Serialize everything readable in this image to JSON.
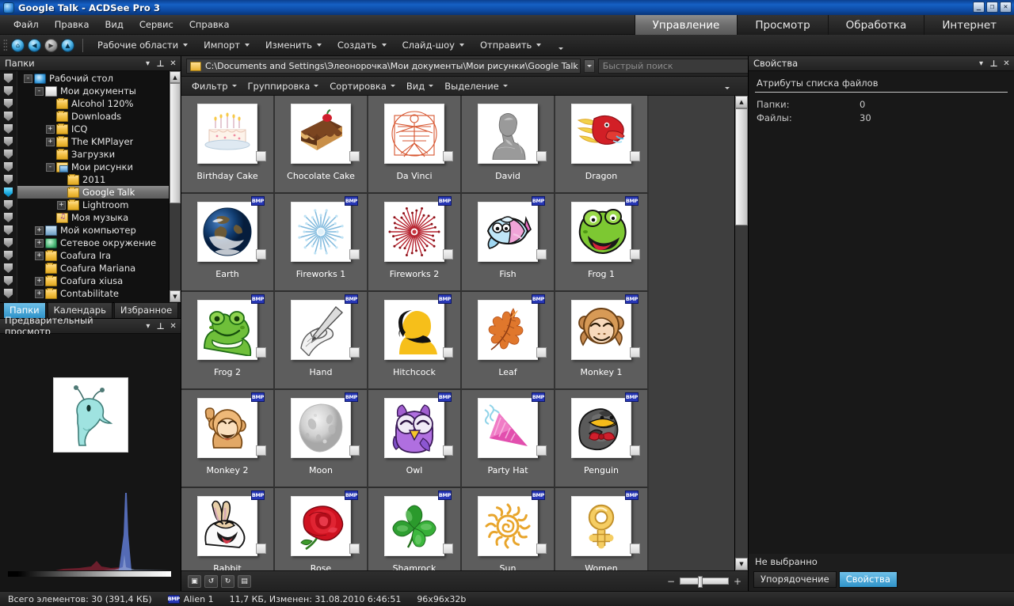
{
  "window": {
    "title": "Google Talk - ACDSee Pro 3",
    "buttons": {
      "minimize": "_",
      "maximize": "❐",
      "close": "✕"
    }
  },
  "menu": [
    "Файл",
    "Правка",
    "Вид",
    "Сервис",
    "Справка"
  ],
  "mode_tabs": [
    {
      "label": "Управление",
      "active": true
    },
    {
      "label": "Просмотр",
      "active": false
    },
    {
      "label": "Обработка",
      "active": false
    },
    {
      "label": "Интернет",
      "active": false
    }
  ],
  "toolbar": {
    "nav_icons": [
      "home-icon",
      "back-icon",
      "forward-icon",
      "up-icon"
    ],
    "items": [
      "Рабочие области",
      "Импорт",
      "Изменить",
      "Создать",
      "Слайд-шоу",
      "Отправить"
    ]
  },
  "left_panel": {
    "title": "Папки",
    "tree": [
      {
        "label": "Рабочий стол",
        "indent": 0,
        "expander": "-",
        "icon": "desktop-icon"
      },
      {
        "label": "Мои документы",
        "indent": 1,
        "expander": "-",
        "icon": "documents-icon"
      },
      {
        "label": "Alcohol 120%",
        "indent": 2,
        "expander": "",
        "icon": "folder-icon"
      },
      {
        "label": "Downloads",
        "indent": 2,
        "expander": "",
        "icon": "folder-icon"
      },
      {
        "label": "ICQ",
        "indent": 2,
        "expander": "+",
        "icon": "folder-icon"
      },
      {
        "label": "The KMPlayer",
        "indent": 2,
        "expander": "+",
        "icon": "folder-icon"
      },
      {
        "label": "Загрузки",
        "indent": 2,
        "expander": "",
        "icon": "folder-icon"
      },
      {
        "label": "Мои рисунки",
        "indent": 2,
        "expander": "-",
        "icon": "pictures-icon"
      },
      {
        "label": "2011",
        "indent": 3,
        "expander": "",
        "icon": "folder-icon"
      },
      {
        "label": "Google Talk",
        "indent": 3,
        "expander": "",
        "icon": "folder-icon",
        "selected": true
      },
      {
        "label": "Lightroom",
        "indent": 3,
        "expander": "+",
        "icon": "folder-icon"
      },
      {
        "label": "Моя музыка",
        "indent": 2,
        "expander": "",
        "icon": "music-icon"
      },
      {
        "label": "Мой компьютер",
        "indent": 1,
        "expander": "+",
        "icon": "computer-icon"
      },
      {
        "label": "Сетевое окружение",
        "indent": 1,
        "expander": "+",
        "icon": "network-icon"
      },
      {
        "label": "Coafura Ira",
        "indent": 1,
        "expander": "+",
        "icon": "folder-icon"
      },
      {
        "label": "Coafura Mariana",
        "indent": 1,
        "expander": "",
        "icon": "folder-icon"
      },
      {
        "label": "Coafura xiusa",
        "indent": 1,
        "expander": "+",
        "icon": "folder-icon"
      },
      {
        "label": "Contabilitate",
        "indent": 1,
        "expander": "+",
        "icon": "folder-icon"
      }
    ],
    "tabs": [
      {
        "label": "Папки",
        "active": true
      },
      {
        "label": "Календарь",
        "active": false
      },
      {
        "label": "Избранное",
        "active": false
      }
    ]
  },
  "preview_panel": {
    "title": "Предварительный просмотр"
  },
  "address_bar": {
    "path": "C:\\Documents and Settings\\Элеонорочка\\Мои документы\\Мои рисунки\\Google Talk",
    "search_placeholder": "Быстрый поиск"
  },
  "filter_bar": [
    "Фильтр",
    "Группировка",
    "Сортировка",
    "Вид",
    "Выделение"
  ],
  "thumbnails": [
    {
      "name": "Birthday Cake",
      "icon": "birthday-cake-thumb",
      "badge": ""
    },
    {
      "name": "Chocolate Cake",
      "icon": "chocolate-cake-thumb",
      "badge": ""
    },
    {
      "name": "Da Vinci",
      "icon": "da-vinci-thumb",
      "badge": ""
    },
    {
      "name": "David",
      "icon": "david-thumb",
      "badge": ""
    },
    {
      "name": "Dragon",
      "icon": "dragon-thumb",
      "badge": ""
    },
    {
      "name": "Earth",
      "icon": "earth-thumb",
      "badge": "BMP"
    },
    {
      "name": "Fireworks 1",
      "icon": "fireworks1-thumb",
      "badge": "BMP"
    },
    {
      "name": "Fireworks 2",
      "icon": "fireworks2-thumb",
      "badge": "BMP"
    },
    {
      "name": "Fish",
      "icon": "fish-thumb",
      "badge": "BMP"
    },
    {
      "name": "Frog 1",
      "icon": "frog1-thumb",
      "badge": "BMP"
    },
    {
      "name": "Frog 2",
      "icon": "frog2-thumb",
      "badge": "BMP"
    },
    {
      "name": "Hand",
      "icon": "hand-thumb",
      "badge": "BMP"
    },
    {
      "name": "Hitchcock",
      "icon": "hitchcock-thumb",
      "badge": "BMP"
    },
    {
      "name": "Leaf",
      "icon": "leaf-thumb",
      "badge": "BMP"
    },
    {
      "name": "Monkey 1",
      "icon": "monkey1-thumb",
      "badge": "BMP"
    },
    {
      "name": "Monkey 2",
      "icon": "monkey2-thumb",
      "badge": "BMP"
    },
    {
      "name": "Moon",
      "icon": "moon-thumb",
      "badge": "BMP"
    },
    {
      "name": "Owl",
      "icon": "owl-thumb",
      "badge": "BMP"
    },
    {
      "name": "Party Hat",
      "icon": "party-hat-thumb",
      "badge": "BMP"
    },
    {
      "name": "Penguin",
      "icon": "penguin-thumb",
      "badge": "BMP"
    },
    {
      "name": "Rabbit",
      "icon": "rabbit-thumb",
      "badge": "BMP"
    },
    {
      "name": "Rose",
      "icon": "rose-thumb",
      "badge": "BMP"
    },
    {
      "name": "Shamrock",
      "icon": "shamrock-thumb",
      "badge": "BMP"
    },
    {
      "name": "Sun",
      "icon": "sun-thumb",
      "badge": "BMP"
    },
    {
      "name": "Women",
      "icon": "women-thumb",
      "badge": "BMP"
    }
  ],
  "bottom_bar": {
    "zoom_minus": "−",
    "zoom_plus": "+"
  },
  "right_panel": {
    "title": "Свойства",
    "section_title": "Атрибуты списка файлов",
    "rows": [
      {
        "key": "Папки:",
        "value": "0"
      },
      {
        "key": "Файлы:",
        "value": "30"
      }
    ],
    "no_selection": "Не выбранно",
    "tabs": [
      {
        "label": "Упорядочение",
        "active": false
      },
      {
        "label": "Свойства",
        "active": true
      }
    ]
  },
  "status_bar": {
    "total": "Всего элементов: 30  (391,4 КБ)",
    "file_format": "BMP",
    "file_name": "Alien 1",
    "file_info": "11,7 КБ, Изменен: 31.08.2010 6:46:51",
    "dimensions": "96x96x32b"
  },
  "colors": {
    "accent": "#2f93c9",
    "titlebar": "#1560c4",
    "badge": "#2737b5",
    "cell_bg": "#5d5d5d"
  }
}
